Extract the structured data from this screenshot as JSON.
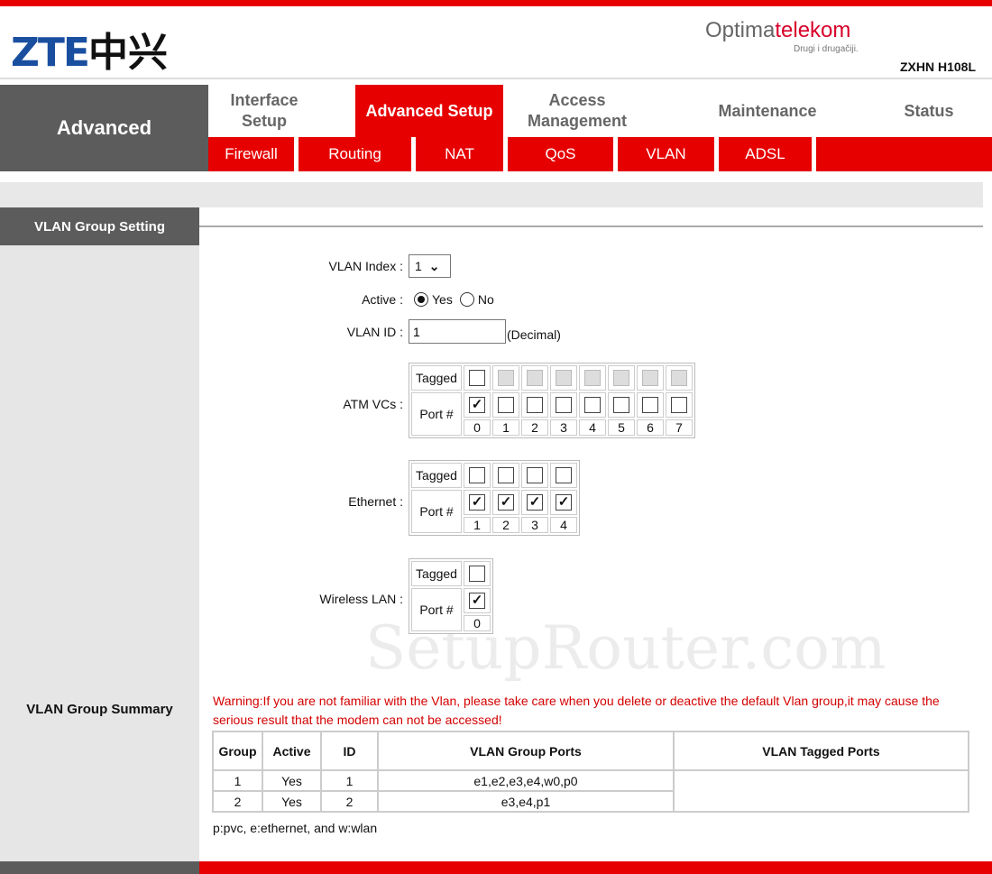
{
  "header": {
    "logo": "ZTE",
    "logo_cn": "中兴",
    "isp_prefix": "Optima",
    "isp_suffix": "telekom",
    "isp_tagline": "Drugi i drugačiji.",
    "model": "ZXHN H108L"
  },
  "nav": {
    "section": "Advanced",
    "tabs": [
      {
        "label": "Interface Setup"
      },
      {
        "label": "Advanced Setup",
        "active": true
      },
      {
        "label": "Access Management"
      },
      {
        "label": "Maintenance"
      },
      {
        "label": "Status"
      }
    ],
    "subtabs": [
      "Firewall",
      "Routing",
      "NAT",
      "QoS",
      "VLAN",
      "ADSL"
    ]
  },
  "sidebar": {
    "section": "VLAN Group Setting",
    "summary": "VLAN Group Summary"
  },
  "form": {
    "vlan_index_label": "VLAN Index :",
    "vlan_index": "1",
    "active_label": "Active :",
    "yes": "Yes",
    "no": "No",
    "active": "Yes",
    "vlan_id_label": "VLAN ID :",
    "vlan_id": "1",
    "decimal": "(Decimal)",
    "atm_label": "ATM VCs :",
    "ethernet_label": "Ethernet :",
    "wlan_label": "Wireless LAN :",
    "tagged": "Tagged",
    "port": "Port #",
    "atm": {
      "ports": [
        "0",
        "1",
        "2",
        "3",
        "4",
        "5",
        "6",
        "7"
      ],
      "tagged": [
        false,
        false,
        false,
        false,
        false,
        false,
        false,
        false
      ],
      "member": [
        true,
        false,
        false,
        false,
        false,
        false,
        false,
        false
      ]
    },
    "ethernet": {
      "ports": [
        "1",
        "2",
        "3",
        "4"
      ],
      "tagged": [
        false,
        false,
        false,
        false
      ],
      "member": [
        true,
        true,
        true,
        true
      ]
    },
    "wlan": {
      "ports": [
        "0"
      ],
      "tagged": [
        false
      ],
      "member": [
        true
      ]
    }
  },
  "summary": {
    "warning": "Warning:If you are not familiar with the Vlan, please take care when you delete or deactive the default Vlan group,it may cause the serious result that the modem can not be accessed!",
    "columns": [
      "Group",
      "Active",
      "ID",
      "VLAN Group Ports",
      "VLAN Tagged Ports"
    ],
    "rows": [
      [
        "1",
        "Yes",
        "1",
        "e1,e2,e3,e4,w0,p0",
        ""
      ],
      [
        "2",
        "Yes",
        "2",
        "e3,e4,p1",
        ""
      ]
    ],
    "legend": "p:pvc, e:ethernet, and w:wlan"
  },
  "watermark": "SetupRouter.com",
  "colors": {
    "brand_red": "#e60000",
    "dark_gray": "#5c5c5c"
  }
}
